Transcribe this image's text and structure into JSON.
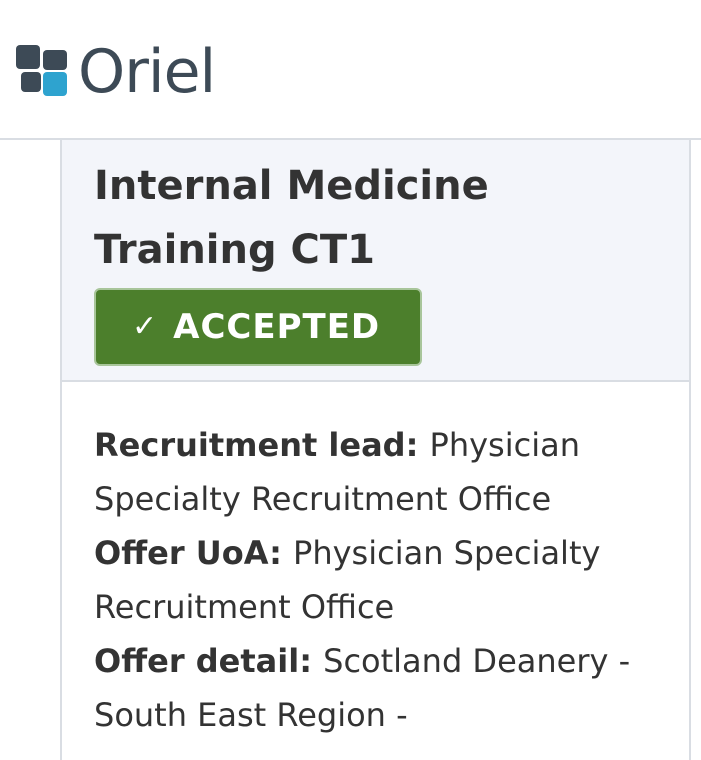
{
  "header": {
    "logo_text": "Oriel",
    "logo_colors": {
      "dark": "#3d4a56",
      "accent": "#2ea3cf"
    }
  },
  "card": {
    "title": "Internal Medicine Training CT1",
    "status": {
      "label": "ACCEPTED",
      "icon": "checkmark-icon",
      "color": "#4c7f2c"
    },
    "details": [
      {
        "label": "Recruitment lead:",
        "value": "Physician Specialty Recruitment Office"
      },
      {
        "label": "Offer UoA:",
        "value": "Physician Specialty Recruitment Office"
      },
      {
        "label": "Offer detail:",
        "value": "Scotland Deanery - South East Region -"
      }
    ]
  }
}
